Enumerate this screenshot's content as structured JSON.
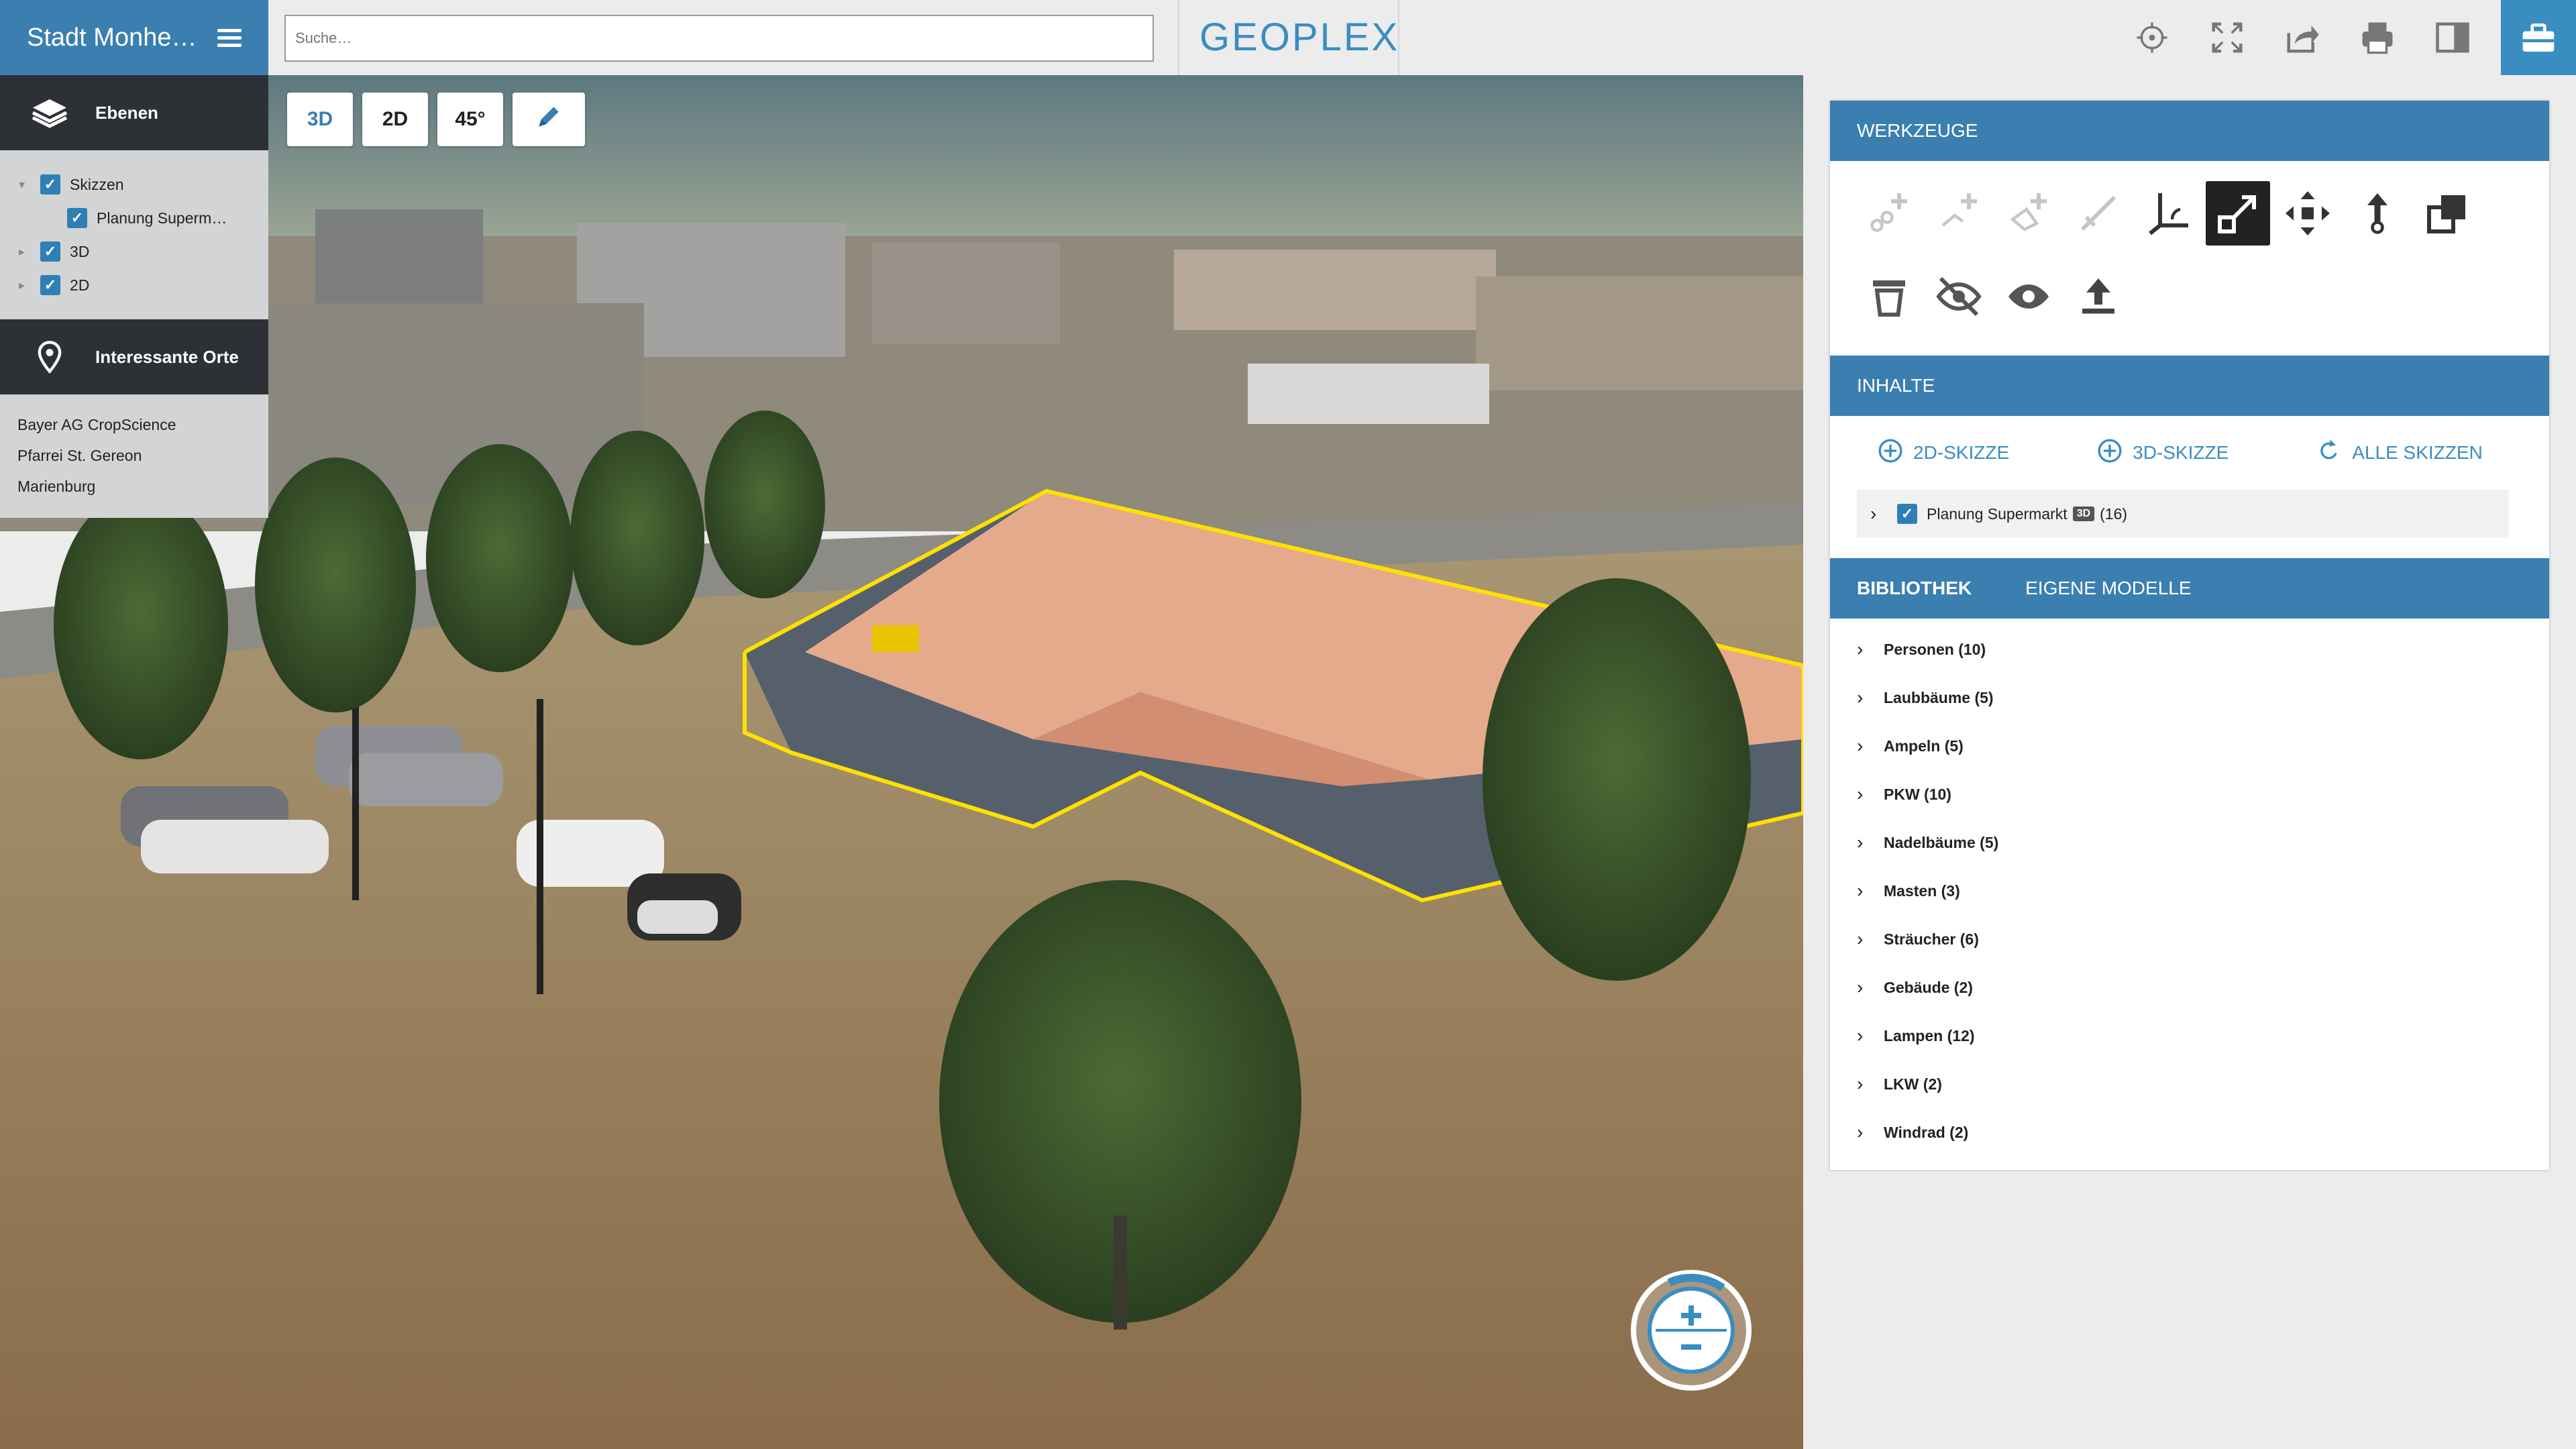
{
  "header": {
    "app_title": "Stadt Monhe…",
    "search_placeholder": "Suche…",
    "logo_text": "GEOPLEX",
    "icons": [
      "locate-icon",
      "fullscreen-icon",
      "share-icon",
      "print-icon",
      "split-view-icon",
      "toolbox-icon"
    ]
  },
  "view_buttons": {
    "b3d": "3D",
    "b2d": "2D",
    "b45": "45°"
  },
  "layers": {
    "title": "Ebenen",
    "items": [
      {
        "label": "Skizzen",
        "checked": true
      },
      {
        "label": "Planung Superm…",
        "checked": true
      },
      {
        "label": "3D",
        "checked": true
      },
      {
        "label": "2D",
        "checked": true
      }
    ]
  },
  "places": {
    "title": "Interessante Orte",
    "items": [
      "Bayer AG CropScience",
      "Pfarrei St. Gereon",
      "Marienburg"
    ]
  },
  "tools_panel": {
    "title": "WERKZEUGE"
  },
  "contents": {
    "title": "INHALTE",
    "add_2d": "2D-SKIZZE",
    "add_3d": "3D-SKIZZE",
    "all_sketches": "ALLE SKIZZEN",
    "sketch_name": "Planung Supermarkt",
    "sketch_badge": "3D",
    "sketch_count": "(16)"
  },
  "library": {
    "tab_library": "BIBLIOTHEK",
    "tab_own": "EIGENE MODELLE",
    "items": [
      "Personen (10)",
      "Laubbäume (5)",
      "Ampeln (5)",
      "PKW (10)",
      "Nadelbäume (5)",
      "Masten (3)",
      "Sträucher (6)",
      "Gebäude (2)",
      "Lampen (12)",
      "LKW (2)",
      "Windrad (2)"
    ]
  },
  "colors": {
    "primary": "#3a7fb0",
    "accent": "#3a8dc1",
    "dark": "#2d3136"
  }
}
